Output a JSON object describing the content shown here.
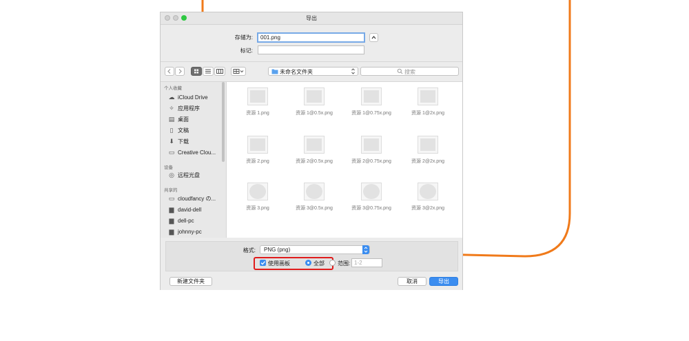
{
  "window": {
    "title": "导出"
  },
  "save": {
    "save_as_label": "存储为:",
    "filename": "001.png",
    "tags_label": "标记:",
    "tags_value": ""
  },
  "toolbar": {
    "location": "未命名文件夹",
    "search_placeholder": "搜索"
  },
  "sidebar": {
    "sections": [
      {
        "header": "个人收藏",
        "items": [
          {
            "label": "iCloud Drive",
            "icon": "cloud-icon"
          },
          {
            "label": "应用程序",
            "icon": "applications-icon"
          },
          {
            "label": "桌面",
            "icon": "desktop-icon"
          },
          {
            "label": "文稿",
            "icon": "documents-icon"
          },
          {
            "label": "下载",
            "icon": "download-icon"
          },
          {
            "label": "Creative Clou...",
            "icon": "folder-icon"
          }
        ]
      },
      {
        "header": "设备",
        "items": [
          {
            "label": "远程光盘",
            "icon": "disc-icon"
          }
        ]
      },
      {
        "header": "共享的",
        "items": [
          {
            "label": "cloudfancy の...",
            "icon": "computer-icon"
          },
          {
            "label": "david-dell",
            "icon": "monitor-icon"
          },
          {
            "label": "dell-pc",
            "icon": "monitor-icon"
          },
          {
            "label": "johnny-pc",
            "icon": "monitor-icon"
          }
        ]
      }
    ]
  },
  "files": [
    {
      "name": "资源 1.png",
      "shape": "rect"
    },
    {
      "name": "资源 1@0.5x.png",
      "shape": "rect"
    },
    {
      "name": "资源 1@0.75x.png",
      "shape": "rect"
    },
    {
      "name": "资源 1@2x.png",
      "shape": "rect"
    },
    {
      "name": "资源 2.png",
      "shape": "rect"
    },
    {
      "name": "资源 2@0.5x.png",
      "shape": "rect"
    },
    {
      "name": "资源 2@0.75x.png",
      "shape": "rect"
    },
    {
      "name": "资源 2@2x.png",
      "shape": "rect"
    },
    {
      "name": "资源 3.png",
      "shape": "circle"
    },
    {
      "name": "资源 3@0.5x.png",
      "shape": "circle"
    },
    {
      "name": "资源 3@0.75x.png",
      "shape": "circle"
    },
    {
      "name": "资源 3@2x.png",
      "shape": "circle"
    }
  ],
  "options": {
    "format_label": "格式:",
    "format_value": "PNG (png)",
    "use_artboards_label": "使用画板",
    "all_label": "全部",
    "range_label": "范围:",
    "range_placeholder": "1-2"
  },
  "buttons": {
    "new_folder": "新建文件夹",
    "cancel": "取消",
    "export": "导出"
  },
  "colors": {
    "annotation_orange": "#f07a1a",
    "highlight_red": "#e01b1b",
    "accent_blue": "#3b8df0"
  }
}
